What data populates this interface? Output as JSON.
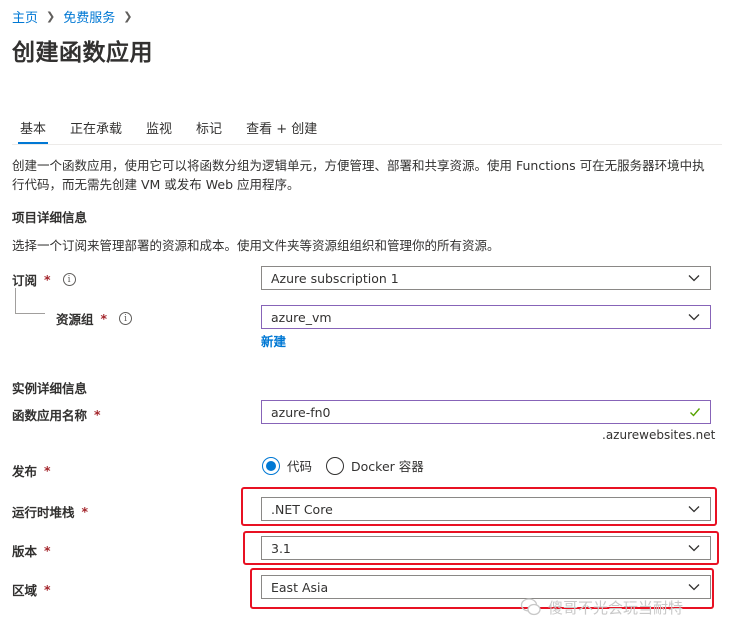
{
  "breadcrumb": {
    "home": "主页",
    "free_services": "免费服务"
  },
  "page_title": "创建函数应用",
  "tabs": [
    {
      "label": "基本"
    },
    {
      "label": "正在承载"
    },
    {
      "label": "监视"
    },
    {
      "label": "标记"
    },
    {
      "label": "查看 + 创建"
    }
  ],
  "description": "创建一个函数应用，使用它可以将函数分组为逻辑单元，方便管理、部署和共享资源。使用 Functions 可在无服务器环境中执行代码，而无需先创建 VM 或发布 Web 应用程序。",
  "project": {
    "heading": "项目详细信息",
    "description": "选择一个订阅来管理部署的资源和成本。使用文件夹等资源组组织和管理你的所有资源。",
    "subscription_label": "订阅",
    "subscription_value": "Azure subscription 1",
    "resource_group_label": "资源组",
    "resource_group_value": "azure_vm",
    "new_link": "新建"
  },
  "instance": {
    "heading": "实例详细信息",
    "name_label": "函数应用名称",
    "name_value": "azure-fn0",
    "domain_suffix": ".azurewebsites.net",
    "publish_label": "发布",
    "publish_code": "代码",
    "publish_docker": "Docker 容器",
    "runtime_label": "运行时堆栈",
    "runtime_value": ".NET Core",
    "version_label": "版本",
    "version_value": "3.1",
    "region_label": "区域",
    "region_value": "East Asia"
  },
  "required_mark": "*",
  "info_glyph": "i",
  "watermark_text": "傻哥不光会玩当耐特",
  "colors": {
    "accent": "#0078d4",
    "highlight_box": "#e81123",
    "focus_border": "#8764b8",
    "valid_check": "#57a300"
  }
}
